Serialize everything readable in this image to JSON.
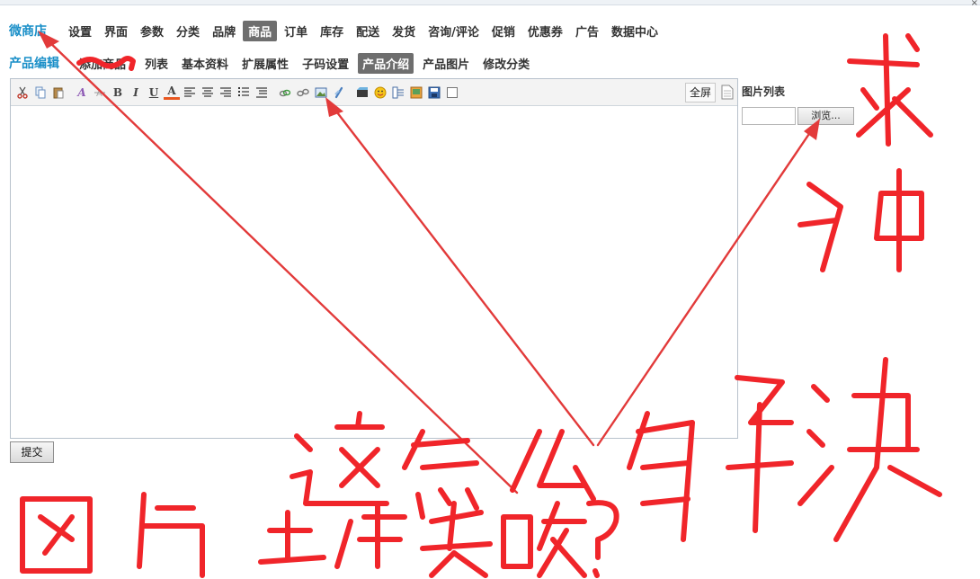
{
  "window": {
    "close_glyph": "×"
  },
  "topnav": {
    "brand": "微商店",
    "items": [
      "设置",
      "界面",
      "参数",
      "分类",
      "品牌",
      "商品",
      "订单",
      "库存",
      "配送",
      "发货",
      "咨询/评论",
      "促销",
      "优惠券",
      "广告",
      "数据中心"
    ],
    "active": "商品"
  },
  "subnav": {
    "title": "产品编辑",
    "obscured_item": "添加商品",
    "items": [
      "列表",
      "基本资料",
      "扩展属性",
      "子码设置",
      "产品介绍",
      "产品图片",
      "修改分类"
    ],
    "active": "产品介绍"
  },
  "toolbar": {
    "icons": [
      "cut-icon",
      "copy-icon",
      "paste-icon",
      "font-icon",
      "strikethrough-icon",
      "bold-icon",
      "italic-icon",
      "underline-icon",
      "font-color-icon",
      "align-left-icon",
      "align-center-icon",
      "align-right-icon",
      "ordered-list-icon",
      "unordered-list-icon",
      "link-icon",
      "unlink-icon",
      "image-icon",
      "anchor-icon",
      "media-icon",
      "emoticon-icon",
      "horizontal-rule-icon",
      "insert-image-icon",
      "save-icon",
      "checkbox-icon"
    ],
    "glyphs": {
      "bold": "B",
      "italic": "I",
      "underline": "U",
      "font_color": "A",
      "font": "A"
    },
    "fullscreen_label": "全屏"
  },
  "image_panel": {
    "title": "图片列表",
    "file_value": "",
    "browse_label": "浏览..."
  },
  "form": {
    "submit_label": "提交"
  },
  "colors": {
    "brand": "#1a8fc8",
    "active_tab": "#6e6e6e",
    "annotation": "#f0252a"
  },
  "annotation": {
    "handwriting": [
      "求神",
      "解决",
      "这怎么",
      "图片上传失败？"
    ]
  }
}
